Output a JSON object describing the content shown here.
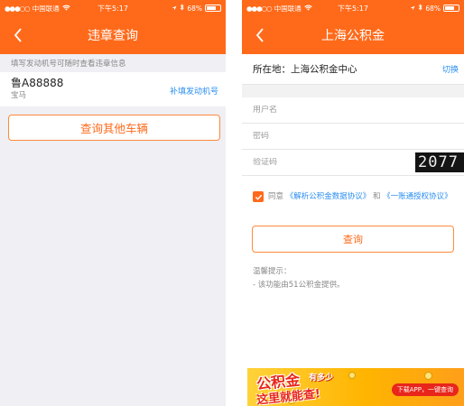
{
  "left": {
    "status": {
      "carrier": "中国联通",
      "time": "下午5:17",
      "battery": "68%",
      "battery_level": 0.68
    },
    "title": "违章查询",
    "hint": "填写发动机号可随时查看违章信息",
    "car": {
      "plate": "鲁A88888",
      "brand": "宝马",
      "add_engine_label": "补填发动机号"
    },
    "query_other_label": "查询其他车辆"
  },
  "right": {
    "status": {
      "carrier": "中国联通",
      "time": "下午5:17",
      "battery": "68%",
      "battery_level": 0.68
    },
    "title": "上海公积金",
    "location_label": "所在地：上海公积金中心",
    "switch_label": "切换",
    "fields": {
      "username_placeholder": "用户名",
      "password_placeholder": "密码",
      "captcha_placeholder": "验证码",
      "captcha_text": "2077"
    },
    "agree": {
      "prefix": "同意",
      "link1": "《解析公积金数据协议》",
      "and": "和",
      "link2": "《一账通授权协议》"
    },
    "query_label": "查询",
    "tips": {
      "title": "温馨提示：",
      "line1": "- 该功能由51公积金提供。"
    },
    "banner": {
      "big": "公积金",
      "ask": "有多少",
      "sub": "这里就能查!",
      "cta": "下载APP，一键查询"
    }
  },
  "colors": {
    "brand_orange": "#ff6a1a",
    "link_blue": "#2a8ef0",
    "background_gray": "#efeff4"
  }
}
